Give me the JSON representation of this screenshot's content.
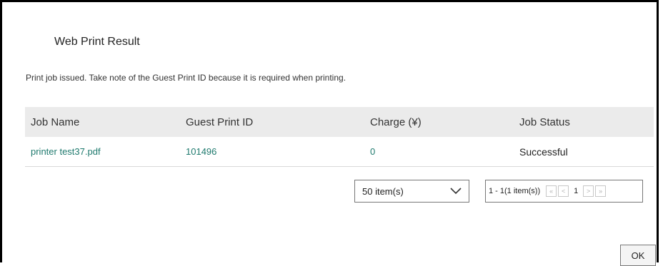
{
  "dialog": {
    "title": "Web Print Result",
    "message": "Print job issued. Take note of the Guest Print ID because it is required when printing."
  },
  "table": {
    "headers": [
      "Job Name",
      "Guest Print ID",
      "Charge (¥)",
      "Job Status"
    ],
    "rows": [
      [
        "printer test37.pdf",
        "101496",
        "0",
        "Successful"
      ]
    ]
  },
  "pagination": {
    "items_per_page": "50 item(s)",
    "range_text": "1 - 1(1 item(s))",
    "current_page": "1",
    "first_icon": "«",
    "prev_icon": "<",
    "next_icon": ">",
    "last_icon": "»"
  },
  "footer": {
    "ok_label": "OK"
  },
  "colors": {
    "link": "#1f7a6e",
    "header_bg": "#ebebeb"
  }
}
